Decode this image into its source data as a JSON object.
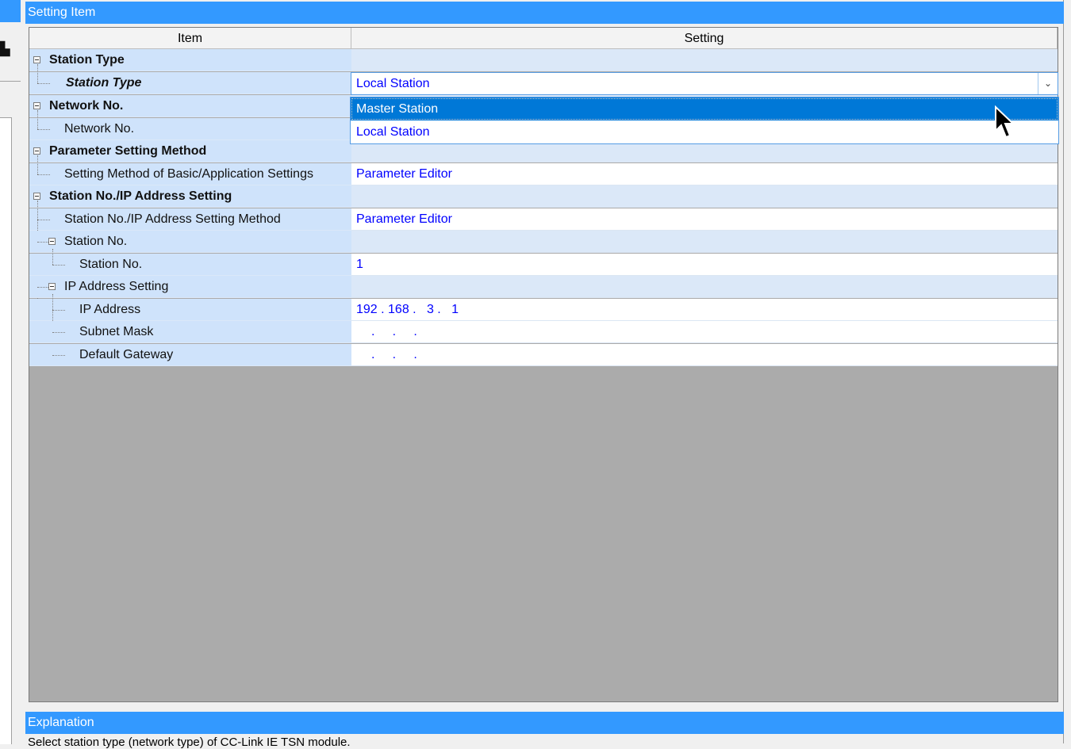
{
  "setting_panel": {
    "title": "Setting Item"
  },
  "columns": {
    "item": "Item",
    "setting": "Setting"
  },
  "rows": [
    {
      "label": "Station Type",
      "value": ""
    },
    {
      "label": "Station Type",
      "value": "Local Station"
    },
    {
      "label": "Network No.",
      "value": ""
    },
    {
      "label": "Network No.",
      "value": ""
    },
    {
      "label": "Parameter Setting Method",
      "value": ""
    },
    {
      "label": "Setting Method of Basic/Application Settings",
      "value": "Parameter Editor"
    },
    {
      "label": "Station No./IP Address Setting",
      "value": ""
    },
    {
      "label": "Station No./IP Address Setting Method",
      "value": "Parameter Editor"
    },
    {
      "label": "Station No.",
      "value": ""
    },
    {
      "label": "Station No.",
      "value": "1"
    },
    {
      "label": "IP Address Setting",
      "value": ""
    },
    {
      "label": "IP Address",
      "value": "192 . 168 .   3 .   1"
    },
    {
      "label": "Subnet Mask",
      "value": ".     .     ."
    },
    {
      "label": "Default Gateway",
      "value": ".     .     ."
    }
  ],
  "dropdown": {
    "selected": "Local Station",
    "options": [
      "Master Station",
      "Local Station"
    ],
    "highlighted": "Master Station"
  },
  "explanation_panel": {
    "title": "Explanation",
    "text": "Select station type (network type) of CC-Link IE TSN module."
  },
  "colors": {
    "header_blue": "#3399ff",
    "value_blue": "#0000ff",
    "item_bg": "#cfe3fb",
    "highlight": "#0078d7"
  }
}
